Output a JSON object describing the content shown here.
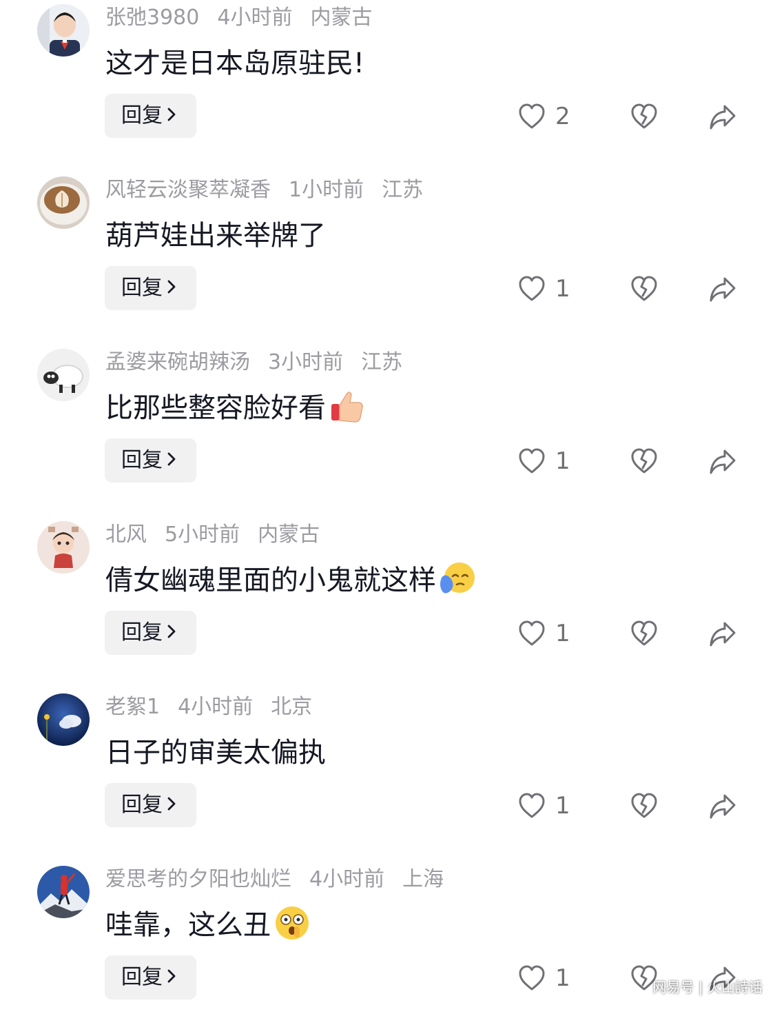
{
  "comments": [
    {
      "username": "张弛3980",
      "time": "4小时前",
      "location": "内蒙古",
      "text": "这才是日本岛原驻民!",
      "emoji": "",
      "reply_label": "回复",
      "likes": "2",
      "avatar_icon": "boy-portrait-avatar"
    },
    {
      "username": "风轻云淡聚萃凝香",
      "time": "1小时前",
      "location": "江苏",
      "text": "葫芦娃出来举牌了",
      "emoji": "",
      "reply_label": "回复",
      "likes": "1",
      "avatar_icon": "latte-cup-avatar"
    },
    {
      "username": "孟婆来碗胡辣汤",
      "time": "3小时前",
      "location": "江苏",
      "text": "比那些整容脸好看",
      "emoji": "thumbs-up-emoji",
      "reply_label": "回复",
      "likes": "1",
      "avatar_icon": "sheep-avatar"
    },
    {
      "username": "北风",
      "time": "5小时前",
      "location": "内蒙古",
      "text": "倩女幽魂里面的小鬼就这样",
      "emoji": "crying-face-emoji",
      "reply_label": "回复",
      "likes": "1",
      "avatar_icon": "cartoon-child-avatar"
    },
    {
      "username": "老絮1",
      "time": "4小时前",
      "location": "北京",
      "text": "日子的审美太偏执",
      "emoji": "",
      "reply_label": "回复",
      "likes": "1",
      "avatar_icon": "night-sky-avatar"
    },
    {
      "username": "爱思考的夕阳也灿烂",
      "time": "4小时前",
      "location": "上海",
      "text": "哇靠，这么丑",
      "emoji": "shocked-face-emoji",
      "reply_label": "回复",
      "likes": "1",
      "avatar_icon": "mountain-climber-avatar"
    }
  ],
  "watermark": "网易号 | 火山詩话",
  "colors": {
    "meta_text": "#9b9ba1",
    "body_text": "#161823",
    "button_bg": "#f1f1f2",
    "icon_stroke": "#6f6f75"
  }
}
